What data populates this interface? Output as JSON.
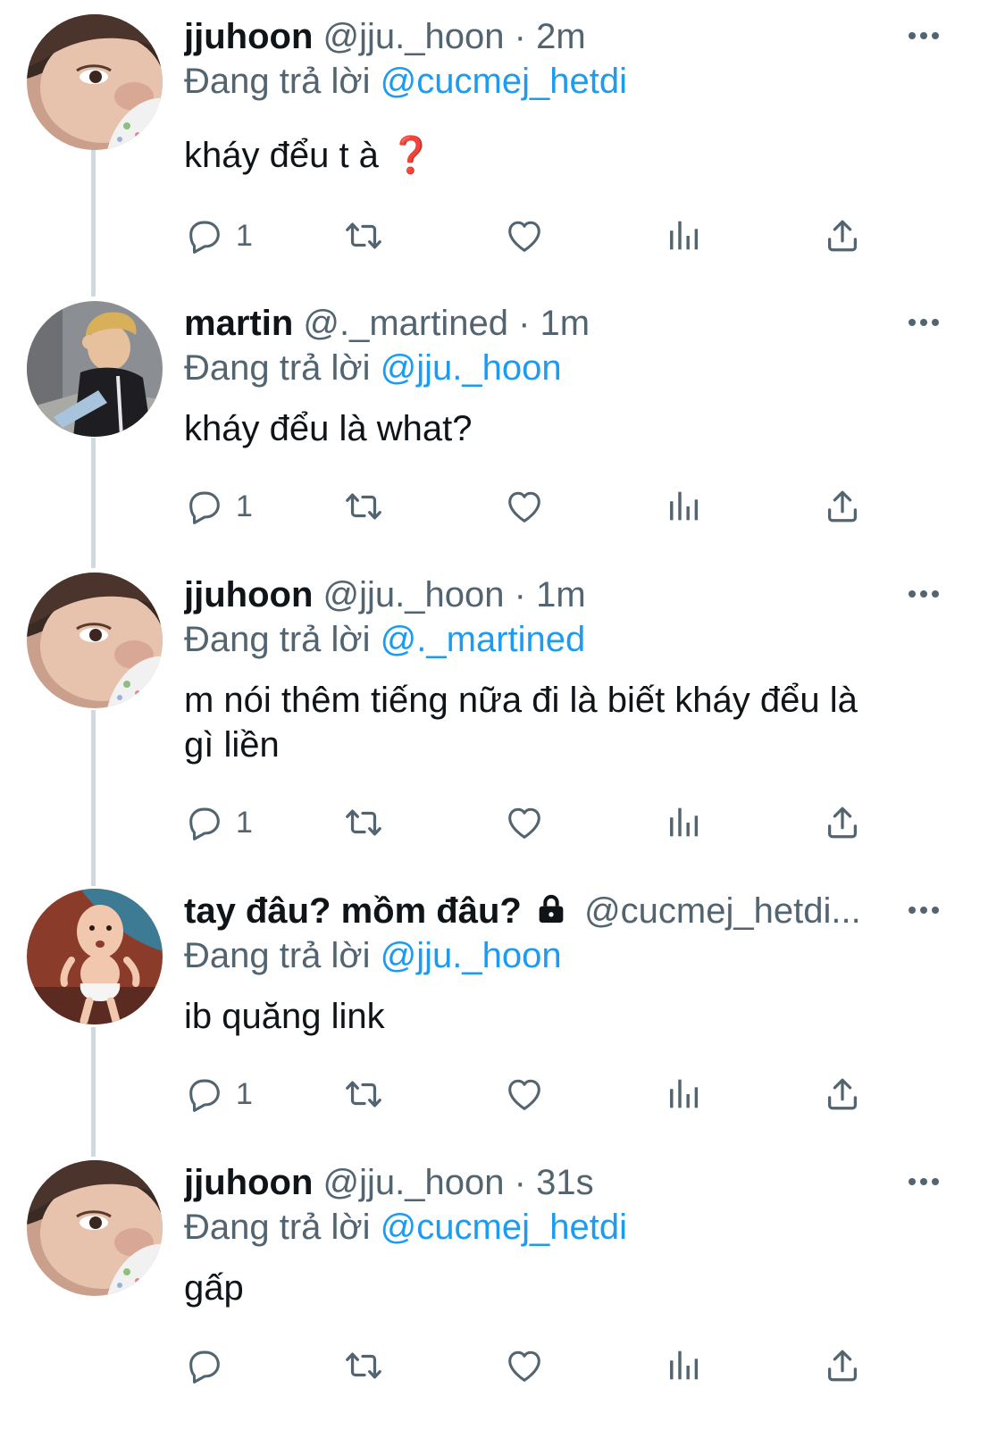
{
  "tweets": [
    {
      "name": "jjuhoon",
      "handle": "@jju._hoon",
      "sep": "·",
      "time": "2m",
      "reply_label": "Đang trả lời",
      "reply_mention": "@cucmej_hetdi",
      "text": "kháy đểu t à",
      "emoji": "❓",
      "reply_count": "1",
      "avatar_icon": "boy-closeup-avatar"
    },
    {
      "name": "martin",
      "handle": "@._martined",
      "sep": "·",
      "time": "1m",
      "reply_label": "Đang trả lời",
      "reply_mention": "@jju._hoon",
      "text": "kháy đểu là what?",
      "reply_count": "1",
      "avatar_icon": "blond-guy-photo-avatar"
    },
    {
      "name": "jjuhoon",
      "handle": "@jju._hoon",
      "sep": "·",
      "time": "1m",
      "reply_label": "Đang trả lời",
      "reply_mention": "@._martined",
      "text_line1": "m nói thêm tiếng nữa đi là biết kháy đểu là",
      "text_line2": "gì liền",
      "reply_count": "1",
      "avatar_icon": "boy-closeup-avatar"
    },
    {
      "name": "tay đâu? mồm đâu?",
      "handle": "@cucmej_hetdi...",
      "reply_label": "Đang trả lời",
      "reply_mention": "@jju._hoon",
      "text": "ib quăng link",
      "reply_count": "1",
      "avatar_icon": "baby-figure-avatar",
      "lock_icon": "lock-icon"
    },
    {
      "name": "jjuhoon",
      "handle": "@jju._hoon",
      "sep": "·",
      "time": "31s",
      "reply_label": "Đang trả lời",
      "reply_mention": "@cucmej_hetdi",
      "text": "gấp",
      "reply_count": "",
      "avatar_icon": "boy-closeup-avatar"
    }
  ],
  "colors": {
    "mention": "#1d9bf0",
    "secondary_text": "#536471",
    "thread_line": "#cfd9de",
    "primary_text": "#0f1419"
  },
  "action_icons": [
    "reply-icon",
    "retweet-icon",
    "like-icon",
    "views-icon",
    "share-icon"
  ]
}
